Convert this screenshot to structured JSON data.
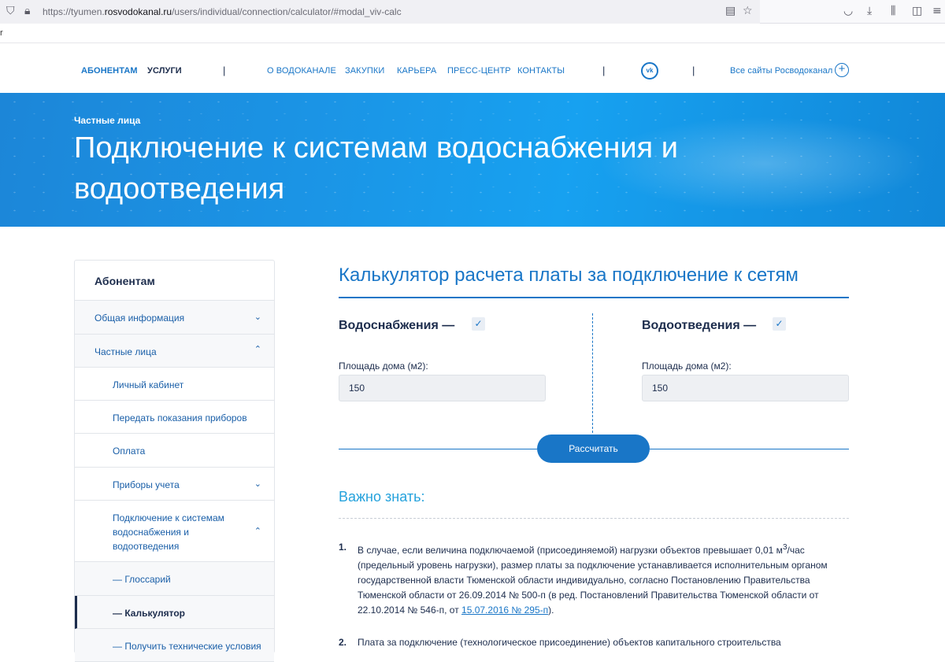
{
  "browser": {
    "url_prefix": "https://tyumen.",
    "url_host": "rosvodokanal.ru",
    "url_path": "/users/individual/connection/calculator/#modal_viv-calc",
    "strip_text": "r"
  },
  "topnav": {
    "items": [
      "АБОНЕНТАМ",
      "УСЛУГИ",
      "О ВОДОКАНАЛЕ",
      "ЗАКУПКИ",
      "КАРЬЕРА",
      "ПРЕСС-ЦЕНТР",
      "КОНТАКТЫ"
    ],
    "vk_label": "vk",
    "all_sites": "Все сайты Росводоканал",
    "accent": "#1976c7"
  },
  "hero": {
    "breadcrumb": "Частные лица",
    "title": "Подключение к системам водоснабжения и водоотведения"
  },
  "sidebar": {
    "heading": "Абонентам",
    "items": [
      "Общая информация",
      "Частные лица",
      "Личный кабинет",
      "Передать показания приборов",
      "Оплата",
      "Приборы учета",
      "Подключение к системам водоснабжения и водоотведения",
      "— Глоссарий",
      "— Калькулятор",
      "— Получить технические условия"
    ]
  },
  "calc": {
    "title": "Калькулятор расчета платы за подключение к сетям",
    "water": {
      "heading": "Водоснабжения —",
      "checked": true,
      "label": "Площадь дома (м2):",
      "value": "150"
    },
    "sewer": {
      "heading": "Водоотведения —",
      "checked": true,
      "label": "Площадь дома (м2):",
      "value": "150"
    },
    "button": "Рассчитать"
  },
  "important": {
    "heading": "Важно знать:",
    "n1": "1.",
    "n2": "2.",
    "note1_pre": "В случае, если величина подключаемой (присоединяемой) нагрузки объектов превышает 0,01 м",
    "note1_sup": "3",
    "note1_mid": "/час (предельный уровень нагрузки), размер платы за подключение устанавливается исполнительным органом государственной власти Тюменской области индивидуально, согласно Постановлению Правительства Тюменской области от 26.09.2014 № 500-п (в ред. Постановлений Правительства Тюменской области от 22.10.2014 № 546-п, от ",
    "note1_link": "15.07.2016 № 295-п",
    "note1_end": ").",
    "note2": "Плата за подключение (технологическое присоединение) объектов капитального строительства"
  }
}
